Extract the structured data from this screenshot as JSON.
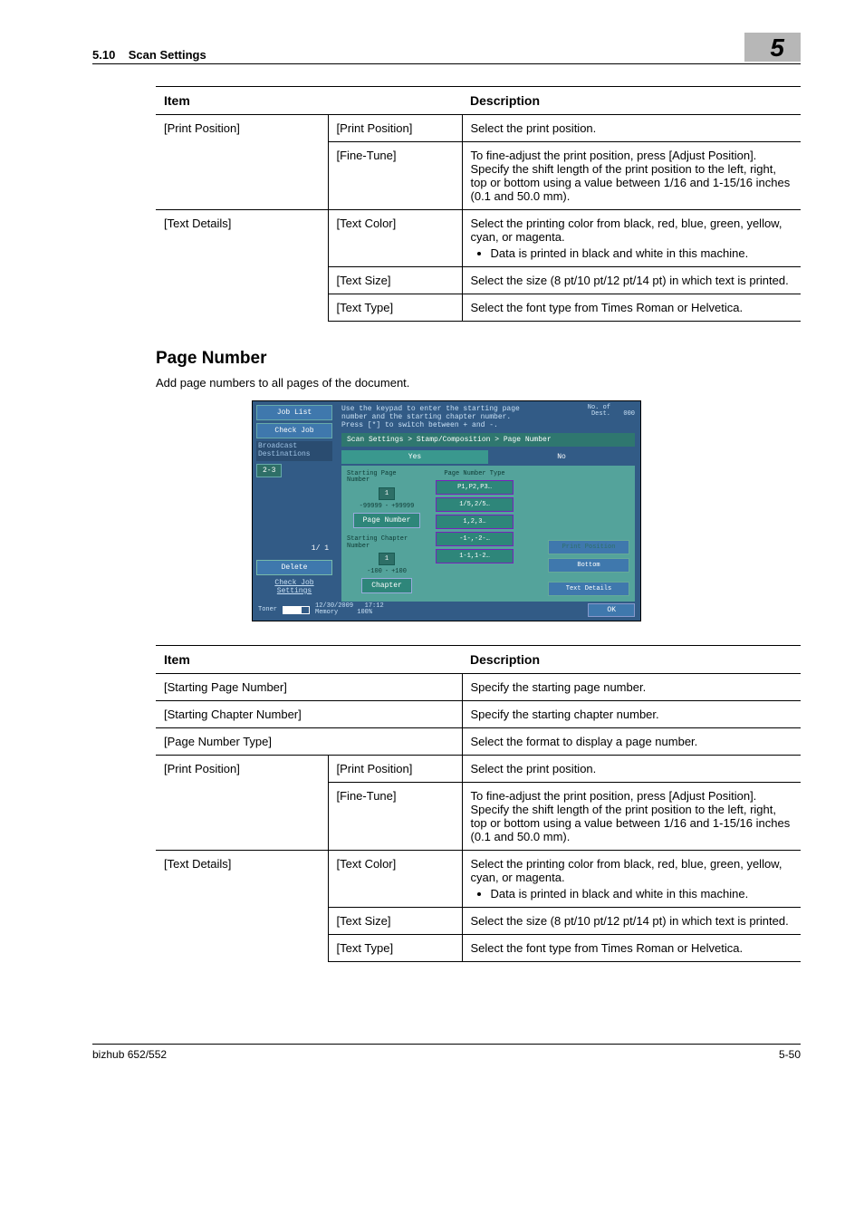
{
  "header": {
    "section_no": "5.10",
    "section_title": "Scan Settings",
    "chapter_no": "5"
  },
  "table1": {
    "head_item": "Item",
    "head_desc": "Description",
    "rows": [
      {
        "a": "[Print Position]",
        "b": "[Print Position]",
        "d": "Select the print position."
      },
      {
        "a": "",
        "b": "[Fine-Tune]",
        "d": "To fine-adjust the print position, press [Adjust Position]. Specify the shift length of the print position to the left, right, top or bottom using a value between 1/16 and 1-15/16 inches (0.1 and 50.0 mm)."
      },
      {
        "a": "[Text Details]",
        "b": "[Text Color]",
        "d": "Select the printing color from black, red, blue, green, yellow, cyan, or magenta.",
        "bullet": "Data is printed in black and white in this machine."
      },
      {
        "a": "",
        "b": "[Text Size]",
        "d": "Select the size (8 pt/10 pt/12 pt/14 pt) in which text is printed."
      },
      {
        "a": "",
        "b": "[Text Type]",
        "d": "Select the font type from Times Roman or Helvetica."
      }
    ]
  },
  "section2": {
    "title": "Page Number",
    "body": "Add page numbers to all pages of the document."
  },
  "panel": {
    "side": {
      "job_list": "Job List",
      "check_job": "Check Job",
      "broadcast": "Broadcast\nDestinations",
      "addr": "2-3",
      "count": "1/  1",
      "delete": "Delete",
      "check_settings": "Check Job\nSettings"
    },
    "msg": "Use the keypad to enter the starting page\nnumber and the starting chapter number.\nPress [*] to switch between + and -.",
    "dest_label": "No. of\nDest.",
    "dest_count": "000",
    "breadcrumb": "Scan Settings > Stamp/Composition > Page Number",
    "yes": "Yes",
    "no": "No",
    "col1": {
      "lbl1": "Starting Page\nNumber",
      "v1": "1",
      "rng1a": "-99999",
      "rng1b": "+99999",
      "btn1": "Page Number",
      "lbl2": "Starting Chapter\nNumber",
      "v2": "1",
      "rng2a": "-100",
      "rng2b": "+100",
      "btn2": "Chapter"
    },
    "col2": {
      "title": "Page Number Type",
      "opts": [
        "P1,P2,P3…",
        "1/5,2/5…",
        "1,2,3…",
        "-1-,-2-…",
        "1-1,1-2…"
      ]
    },
    "col3": {
      "pp": "Print Position",
      "pv": "Bottom",
      "td": "Text Details"
    },
    "bottom": {
      "toner": "Toner",
      "date": "12/30/2009",
      "time": "17:12",
      "mem": "Memory",
      "memv": "100%",
      "ok": "OK"
    }
  },
  "table2": {
    "head_item": "Item",
    "head_desc": "Description",
    "rows": [
      {
        "a": "[Starting Page Number]",
        "span": true,
        "d": "Specify the starting page number."
      },
      {
        "a": "[Starting Chapter Number]",
        "span": true,
        "d": "Specify the starting chapter number."
      },
      {
        "a": "[Page Number Type]",
        "span": true,
        "d": "Select the format to display a page number."
      },
      {
        "a": "[Print Position]",
        "b": "[Print Position]",
        "d": "Select the print position."
      },
      {
        "a": "",
        "b": "[Fine-Tune]",
        "d": "To fine-adjust the print position, press [Adjust Position]. Specify the shift length of the print position to the left, right, top or bottom using a value between 1/16 and 1-15/16 inches (0.1 and 50.0 mm)."
      },
      {
        "a": "[Text Details]",
        "b": "[Text Color]",
        "d": "Select the printing color from black, red, blue, green, yellow, cyan, or magenta.",
        "bullet": "Data is printed in black and white in this machine."
      },
      {
        "a": "",
        "b": "[Text Size]",
        "d": "Select the size (8 pt/10 pt/12 pt/14 pt) in which text is printed."
      },
      {
        "a": "",
        "b": "[Text Type]",
        "d": "Select the font type from Times Roman or Helvetica."
      }
    ]
  },
  "footer": {
    "left": "bizhub 652/552",
    "right": "5-50"
  }
}
